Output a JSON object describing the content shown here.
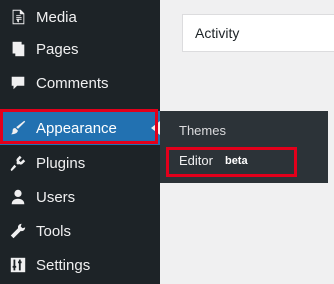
{
  "sidebar": {
    "items": [
      {
        "label": "Media",
        "icon": "media-icon"
      },
      {
        "label": "Pages",
        "icon": "pages-icon"
      },
      {
        "label": "Comments",
        "icon": "comments-icon"
      },
      {
        "label": "Appearance",
        "icon": "paintbrush-icon"
      },
      {
        "label": "Plugins",
        "icon": "plugins-icon"
      },
      {
        "label": "Users",
        "icon": "users-icon"
      },
      {
        "label": "Tools",
        "icon": "wrench-icon"
      },
      {
        "label": "Settings",
        "icon": "settings-icon"
      }
    ],
    "active_color": "#2271b1",
    "background_color": "#1d2327"
  },
  "submenu": {
    "items": [
      {
        "label": "Themes"
      },
      {
        "label": "Editor",
        "badge": "beta"
      }
    ],
    "background_color": "#2c3338"
  },
  "main": {
    "activity_title": "Activity"
  },
  "highlight_color": "#e3001b"
}
